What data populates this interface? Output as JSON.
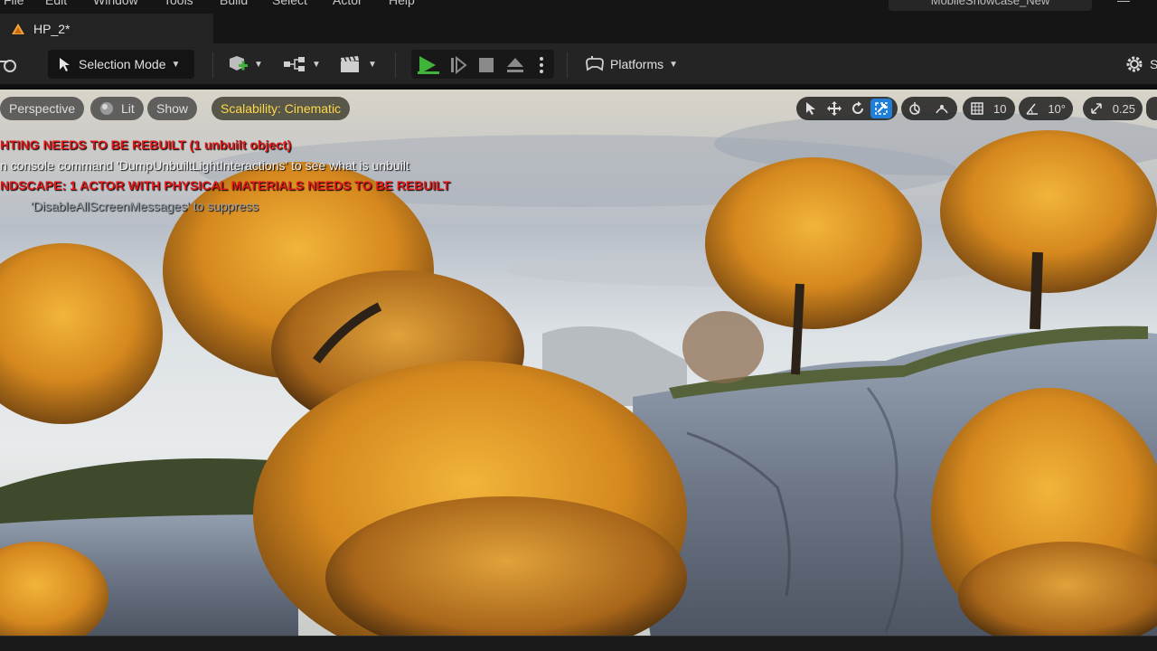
{
  "menu": {
    "items": [
      "File",
      "Edit",
      "Window",
      "Tools",
      "Build",
      "Select",
      "Actor",
      "Help"
    ],
    "project_name": "MobileShowcase_New"
  },
  "tab": {
    "label": "HP_2*",
    "icon": "unreal-level-icon"
  },
  "toolbar": {
    "selection_mode": "Selection Mode",
    "platforms": "Platforms",
    "settings_partial": "S",
    "icons": [
      "content-browser-icon",
      "add-actor-icon",
      "blueprint-icon",
      "cinematics-icon",
      "play-icon",
      "advance-frame-icon",
      "stop-icon",
      "eject-icon",
      "more-options-icon",
      "platforms-icon",
      "settings-icon"
    ],
    "play_color": "#3fb33a"
  },
  "viewport": {
    "view_mode": "Perspective",
    "lighting": "Lit",
    "show": "Show",
    "scalability": "Scalability: Cinematic",
    "grid_snap": "10",
    "rotation_snap": "10°",
    "scale_snap": "0.25",
    "active_color": "#1f7fd8",
    "messages": [
      "HTING NEEDS TO BE REBUILT (1 unbuilt object)",
      "n console command 'DumpUnbuiltLightInteractions' to see what is unbuilt",
      "NDSCAPE: 1 ACTOR WITH PHYSICAL MATERIALS NEEDS TO BE REBUILT",
      "'DisableAllScreenMessages' to suppress"
    ]
  }
}
